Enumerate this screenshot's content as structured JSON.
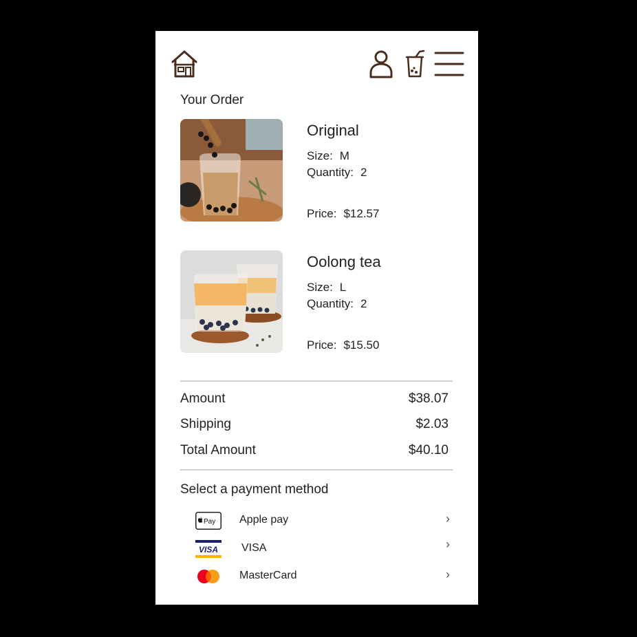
{
  "header": {
    "icons": [
      "home-icon",
      "user-icon",
      "bubble-tea-cup-icon",
      "hamburger-menu-icon"
    ],
    "brand_color": "#4a2c1d"
  },
  "order": {
    "title": "Your Order",
    "size_label": "Size:",
    "quantity_label": "Quantity:",
    "price_label": "Price:",
    "items": [
      {
        "name": "Original",
        "size": "M",
        "quantity": "2",
        "price": "$12.57"
      },
      {
        "name": "Oolong tea",
        "size": "L",
        "quantity": "2",
        "price": "$15.50"
      }
    ]
  },
  "summary": {
    "amount_label": "Amount",
    "amount": "$38.07",
    "shipping_label": "Shipping",
    "shipping": "$2.03",
    "total_label": "Total Amount",
    "total": "$40.10"
  },
  "payment": {
    "title": "Select a payment method",
    "methods": [
      {
        "label": "Apple pay",
        "icon": "apple-pay-icon"
      },
      {
        "label": "VISA",
        "icon": "visa-icon"
      },
      {
        "label": "MasterCard",
        "icon": "mastercard-icon"
      }
    ],
    "chevron": "›"
  }
}
